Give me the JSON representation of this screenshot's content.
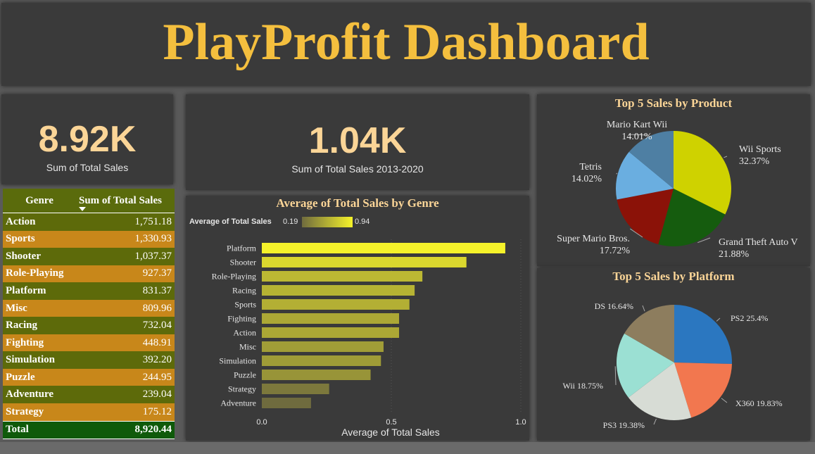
{
  "title": "PlayProfit Dashboard",
  "kpi_total": {
    "value": "8.92K",
    "label": "Sum of  Total Sales"
  },
  "kpi_period": {
    "value": "1.04K",
    "label": "Sum of Total Sales 2013-2020"
  },
  "genre_table": {
    "headers": [
      "Genre",
      "Sum of Total Sales"
    ],
    "rows": [
      {
        "genre": "Action",
        "value": "1,751.18"
      },
      {
        "genre": "Sports",
        "value": "1,330.93"
      },
      {
        "genre": "Shooter",
        "value": "1,037.37"
      },
      {
        "genre": "Role-Playing",
        "value": "927.37"
      },
      {
        "genre": "Platform",
        "value": "831.37"
      },
      {
        "genre": "Misc",
        "value": "809.96"
      },
      {
        "genre": "Racing",
        "value": "732.04"
      },
      {
        "genre": "Fighting",
        "value": "448.91"
      },
      {
        "genre": "Simulation",
        "value": "392.20"
      },
      {
        "genre": "Puzzle",
        "value": "244.95"
      },
      {
        "genre": "Adventure",
        "value": "239.04"
      },
      {
        "genre": "Strategy",
        "value": "175.12"
      }
    ],
    "total_label": "Total",
    "total_value": "8,920.44"
  },
  "chart_data": [
    {
      "type": "bar",
      "title": "Average of Total Sales by Genre",
      "xlabel": "Average of Total Sales",
      "ylabel": "",
      "legend": {
        "label": "Average of Total Sales",
        "min": "0.19",
        "max": "0.94"
      },
      "categories": [
        "Platform",
        "Shooter",
        "Role-Playing",
        "Racing",
        "Sports",
        "Fighting",
        "Action",
        "Misc",
        "Simulation",
        "Puzzle",
        "Strategy",
        "Adventure"
      ],
      "values": [
        0.94,
        0.79,
        0.62,
        0.59,
        0.57,
        0.53,
        0.53,
        0.47,
        0.46,
        0.42,
        0.26,
        0.19
      ],
      "xlim": [
        0,
        1.0
      ],
      "xticks": [
        "0.0",
        "0.5",
        "1.0"
      ],
      "colors": {
        "low": "#6f6b3e",
        "high": "#f5f22a"
      }
    },
    {
      "type": "pie",
      "title": "Top 5 Sales by Product",
      "slices": [
        {
          "label": "Wii Sports",
          "pct": "32.37%",
          "value": 32.37,
          "color": "#cfd200"
        },
        {
          "label": "Grand Theft Auto V",
          "pct": "21.88%",
          "value": 21.88,
          "color": "#155c0e"
        },
        {
          "label": "Super Mario Bros.",
          "pct": "17.72%",
          "value": 17.72,
          "color": "#8b1208"
        },
        {
          "label": "Tetris",
          "pct": "14.02%",
          "value": 14.02,
          "color": "#6aaee0"
        },
        {
          "label": "Mario Kart Wii",
          "pct": "14.01%",
          "value": 14.01,
          "color": "#4e7fa3"
        }
      ]
    },
    {
      "type": "pie",
      "title": "Top 5 Sales by Platform",
      "slices": [
        {
          "label": "PS2 25.4%",
          "value": 25.4,
          "color": "#2b77c0"
        },
        {
          "label": "X360 19.83%",
          "value": 19.83,
          "color": "#f2774f"
        },
        {
          "label": "PS3 19.38%",
          "value": 19.38,
          "color": "#d7dcd5"
        },
        {
          "label": "Wii 18.75%",
          "value": 18.75,
          "color": "#9be0d3"
        },
        {
          "label": "DS 16.64%",
          "value": 16.64,
          "color": "#8d7d5e"
        }
      ]
    }
  ]
}
